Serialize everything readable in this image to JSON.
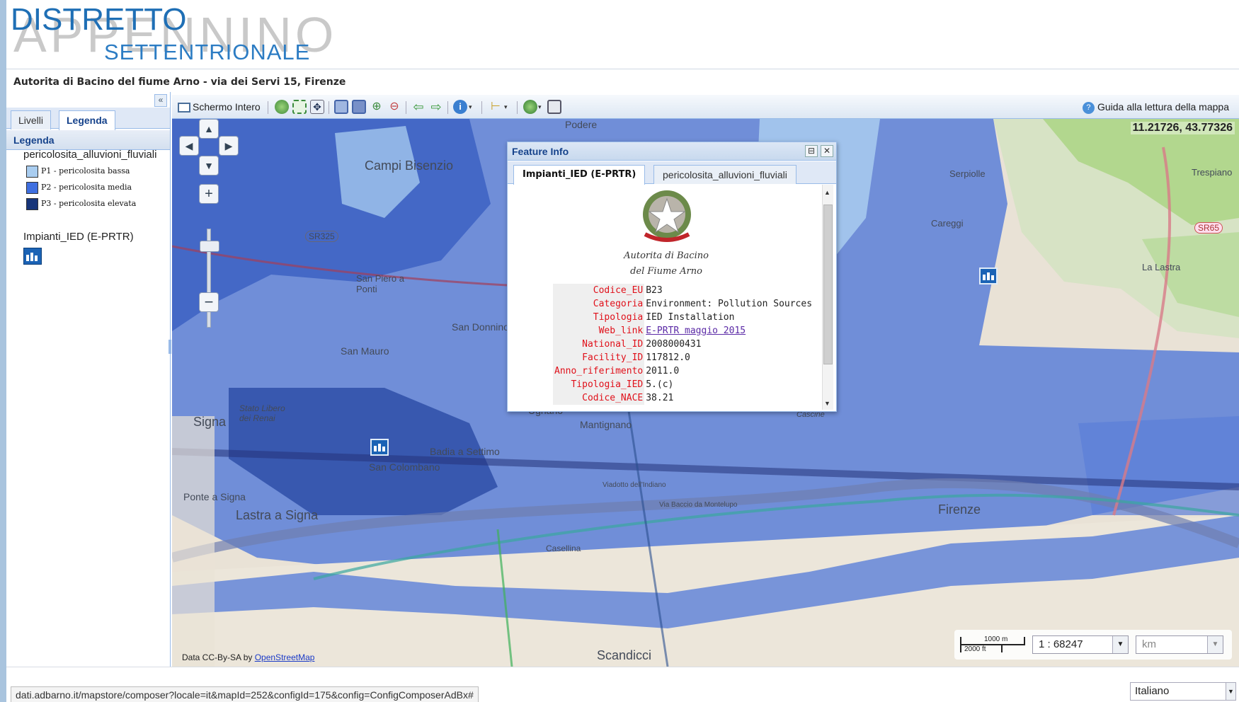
{
  "header": {
    "logo_top": "DISTRETTO",
    "logo_big": "APPENNINO",
    "logo_sub": "SETTENTRIONALE",
    "subtitle": "Autorita di Bacino del fiume Arno - via dei Servi 15, Firenze"
  },
  "left_panel": {
    "collapse": "«",
    "tabs": [
      "Livelli",
      "Legenda"
    ],
    "active_tab": "Legenda",
    "title": "Legenda",
    "legend": {
      "group1": "pericolosita_alluvioni_fluviali",
      "items": [
        {
          "label": "P1 - pericolosita bassa",
          "color": "#a9cdf0"
        },
        {
          "label": "P2 - pericolosita media",
          "color": "#3f6fe0"
        },
        {
          "label": "P3 - pericolosita elevata",
          "color": "#17357a"
        }
      ],
      "group2": "Impianti_IED (E-PRTR)"
    }
  },
  "toolbar": {
    "fullscreen_label": "Schermo Intero",
    "guide_label": "Guida alla lettura della mappa",
    "icons": [
      "fullscreen-icon",
      "globe-icon",
      "zoom-extent-icon",
      "pan-icon",
      "zoom-box-in-icon",
      "zoom-box-out-icon",
      "zoom-in-icon",
      "zoom-out-icon",
      "back-arrow-icon",
      "forward-arrow-icon",
      "info-icon",
      "measure-icon",
      "layers-icon",
      "print-icon"
    ]
  },
  "map": {
    "coords": "11.21726, 43.77326",
    "labels": {
      "campi": "Campi Bisenzio",
      "podere": "Podere",
      "sr325": "SR325",
      "sanpiero": "San Piero a Ponti",
      "sandonnino": "San Donnino",
      "sanmauro": "San Mauro",
      "signa": "Signa",
      "statolibero": "Stato Libero dei Renai",
      "ugnano": "Ugnano",
      "mantignano": "Mantignano",
      "badia": "Badia a Settimo",
      "sancolombano": "San Colombano",
      "ponteasigna": "Ponte a Signa",
      "lastra": "Lastra a Signa",
      "firenze": "Firenze",
      "scandicci": "Scandicci",
      "casellina": "Casellina",
      "serpiolle": "Serpiolle",
      "trespiano": "Trespiano",
      "careggi": "Careggi",
      "lalastra": "La Lastra",
      "sr65": "SR65",
      "parco": "Parco delle Cascine",
      "viabaccio": "Via Baccio da Montelupo",
      "viadotto": "Viadotto dell'Indiano"
    },
    "attribution_prefix": "Data CC-By-SA by ",
    "attribution_link": "OpenStreetMap",
    "scale_bar": {
      "top": "1000 m",
      "bottom": "2000 ft"
    },
    "scale_value": "1 : 68247",
    "units": "km"
  },
  "popup": {
    "title": "Feature Info",
    "tabs": [
      "Impianti_IED (E-PRTR)",
      "pericolosita_alluvioni_fluviali"
    ],
    "autorita_line1": "Autorita di Bacino",
    "autorita_line2": "del Fiume Arno",
    "attributes": [
      {
        "key": "Codice_EU",
        "value": "B23"
      },
      {
        "key": "Categoria",
        "value": "Environment: Pollution Sources"
      },
      {
        "key": "Tipologia",
        "value": "IED Installation"
      },
      {
        "key": "Web_link",
        "value": "E-PRTR maggio 2015"
      },
      {
        "key": "National_ID",
        "value": "2008000431"
      },
      {
        "key": "Facility_ID",
        "value": "117812.0"
      },
      {
        "key": "Anno_riferimento",
        "value": "2011.0"
      },
      {
        "key": "Tipologia_IED",
        "value": "5.(c)"
      },
      {
        "key": "Codice_NACE",
        "value": "38.21"
      }
    ]
  },
  "footer": {
    "url": "dati.adbarno.it/mapstore/composer?locale=it&mapId=252&configId=175&config=ConfigComposerAdBx#",
    "language": "Italiano"
  }
}
